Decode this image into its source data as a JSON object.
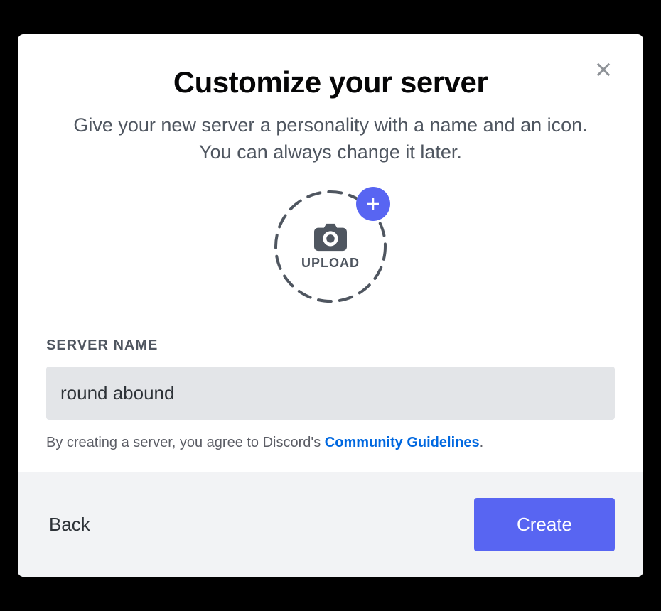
{
  "modal": {
    "title": "Customize your server",
    "subtitle": "Give your new server a personality with a name and an icon. You can always change it later.",
    "upload_label": "UPLOAD",
    "server_name_label": "SERVER NAME",
    "server_name_value": "round abound",
    "consent_prefix": "By creating a server, you agree to Discord's ",
    "consent_link_text": "Community Guidelines",
    "consent_suffix": ".",
    "back_label": "Back",
    "create_label": "Create"
  },
  "colors": {
    "accent": "#5865f2",
    "link": "#0068e0"
  }
}
